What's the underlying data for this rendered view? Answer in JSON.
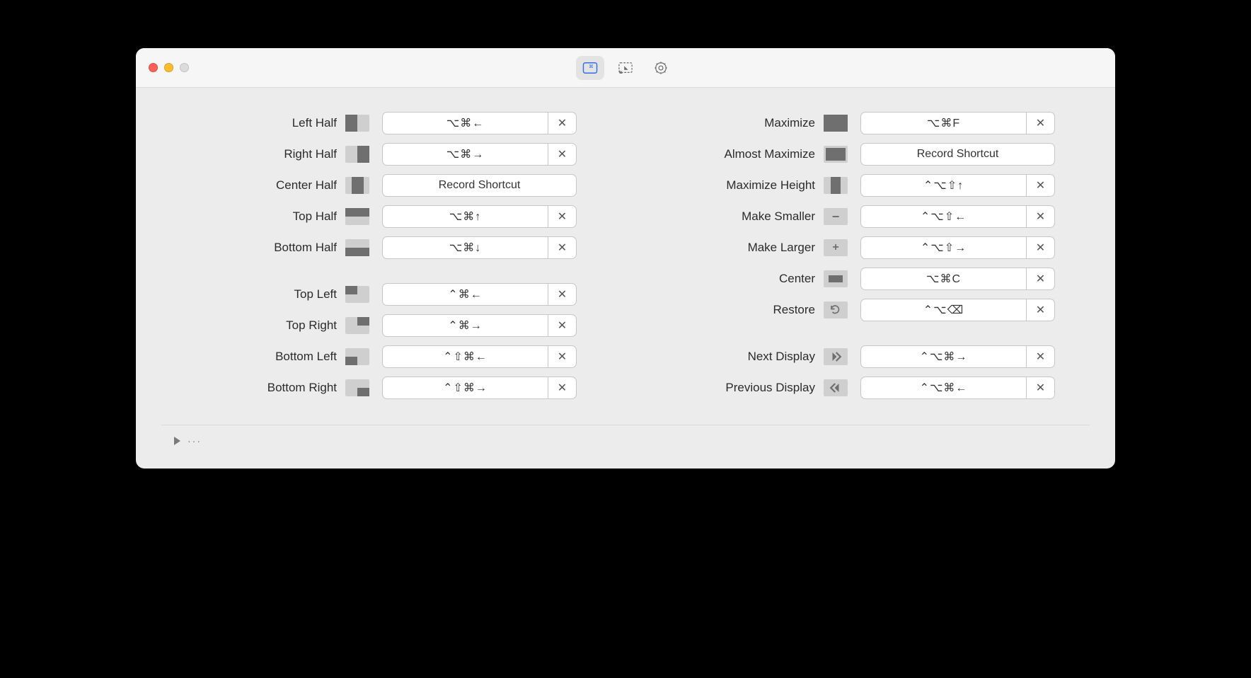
{
  "toolbar": {
    "tab_shortcuts": "Shortcuts",
    "tab_snap": "Snap Areas",
    "tab_settings": "Settings"
  },
  "record_label": "Record Shortcut",
  "clear_symbol": "✕",
  "footer": {
    "dots": "···"
  },
  "left": {
    "g1": [
      {
        "label": "Left Half",
        "shortcut": "⌥⌘←",
        "icon": "left-half"
      },
      {
        "label": "Right Half",
        "shortcut": "⌥⌘→",
        "icon": "right-half"
      },
      {
        "label": "Center Half",
        "shortcut": null,
        "icon": "center-half"
      },
      {
        "label": "Top Half",
        "shortcut": "⌥⌘↑",
        "icon": "top-half"
      },
      {
        "label": "Bottom Half",
        "shortcut": "⌥⌘↓",
        "icon": "bottom-half"
      }
    ],
    "g2": [
      {
        "label": "Top Left",
        "shortcut": "⌃⌘←",
        "icon": "top-left"
      },
      {
        "label": "Top Right",
        "shortcut": "⌃⌘→",
        "icon": "top-right"
      },
      {
        "label": "Bottom Left",
        "shortcut": "⌃⇧⌘←",
        "icon": "bottom-left"
      },
      {
        "label": "Bottom Right",
        "shortcut": "⌃⇧⌘→",
        "icon": "bottom-right"
      }
    ]
  },
  "right": {
    "g1": [
      {
        "label": "Maximize",
        "shortcut": "⌥⌘F",
        "icon": "maximize"
      },
      {
        "label": "Almost Maximize",
        "shortcut": null,
        "icon": "almost-max"
      },
      {
        "label": "Maximize Height",
        "shortcut": "⌃⌥⇧↑",
        "icon": "max-height"
      },
      {
        "label": "Make Smaller",
        "shortcut": "⌃⌥⇧←",
        "icon": "make-smaller"
      },
      {
        "label": "Make Larger",
        "shortcut": "⌃⌥⇧→",
        "icon": "make-larger"
      },
      {
        "label": "Center",
        "shortcut": "⌥⌘C",
        "icon": "center-win"
      },
      {
        "label": "Restore",
        "shortcut": "⌃⌥⌫",
        "icon": "restore"
      }
    ],
    "g2": [
      {
        "label": "Next Display",
        "shortcut": "⌃⌥⌘→",
        "icon": "next-display"
      },
      {
        "label": "Previous Display",
        "shortcut": "⌃⌥⌘←",
        "icon": "prev-display"
      }
    ]
  }
}
